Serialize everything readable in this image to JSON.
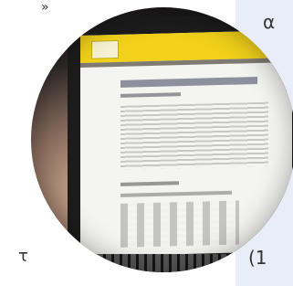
{
  "labels": {
    "top_left": "»",
    "top_right": "α",
    "bottom_left": "τ",
    "bottom_right": "(1"
  }
}
